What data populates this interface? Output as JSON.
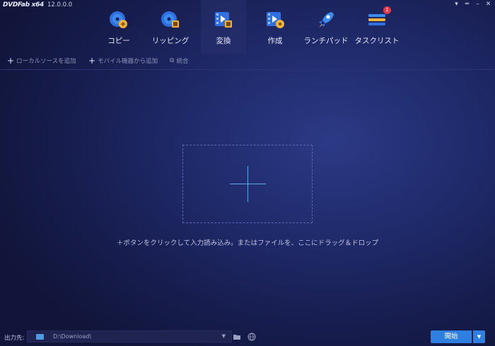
{
  "app": {
    "logo_text": "DVDFab x64",
    "version": "12.0.0.0"
  },
  "window_controls": [
    "▾",
    "═",
    "–",
    "✕"
  ],
  "nav": [
    {
      "label": "コピー",
      "icon": "copy-disc-icon"
    },
    {
      "label": "リッピング",
      "icon": "ripper-disc-icon"
    },
    {
      "label": "変換",
      "icon": "converter-film-icon",
      "active": true
    },
    {
      "label": "作成",
      "icon": "creator-film-icon"
    },
    {
      "label": "ランチパッド",
      "icon": "launchpad-rocket-icon"
    },
    {
      "label": "タスクリスト",
      "icon": "task-list-icon",
      "badge": "1"
    }
  ],
  "toolbar": {
    "add_local": "ローカルソースを追加",
    "add_mobile": "モバイル機器から追加",
    "merge": "統合"
  },
  "main": {
    "hint": "＋ボタンをクリックして入力読み込み。またはファイルを、ここにドラッグ＆ドロップ"
  },
  "footer": {
    "output_label": "出力先:",
    "output_path": "D:\\Download\\",
    "start_label": "開始"
  },
  "colors": {
    "accent": "#2f7fe0",
    "badge": "#e23a4b"
  }
}
